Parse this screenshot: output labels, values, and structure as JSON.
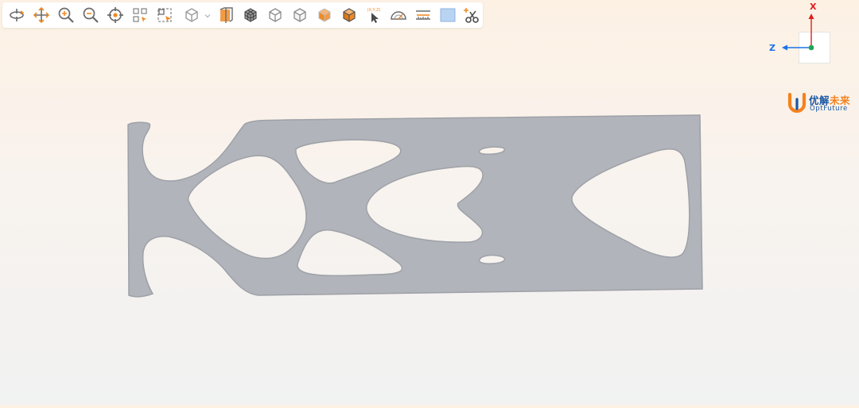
{
  "colors": {
    "icon_gray": "#6b6b6b",
    "accent_orange": "#f08a24",
    "part_gray": "#b1b4ba",
    "part_edge": "#9ea1a7",
    "axis_x": "#e02020",
    "axis_z": "#1a73e8",
    "axis_y": "#23a455",
    "logo_blue": "#1a57a5",
    "logo_orange": "#f5821f",
    "select_blue": "#b9d3f2"
  },
  "toolbar": {
    "buttons": [
      {
        "id": "rotate",
        "icon": "rotate-icon"
      },
      {
        "id": "pan",
        "icon": "pan-icon"
      },
      {
        "id": "zoom-in",
        "icon": "zoom-in-icon"
      },
      {
        "id": "zoom-out",
        "icon": "zoom-out-icon"
      },
      {
        "id": "fit-center",
        "icon": "crosshair-icon"
      },
      {
        "id": "zoom-window",
        "icon": "zoom-window-icon"
      },
      {
        "id": "zoom-box",
        "icon": "zoom-box-icon"
      },
      {
        "id": "view-cube-menu",
        "icon": "cube-dropdown-icon"
      },
      {
        "id": "section-view",
        "icon": "section-plane-icon"
      },
      {
        "id": "mesh-view",
        "icon": "mesh-cube-icon"
      },
      {
        "id": "wireframe-view",
        "icon": "wireframe-cube-icon"
      },
      {
        "id": "hidden-line-view",
        "icon": "hidden-line-cube-icon"
      },
      {
        "id": "shaded-edges-view",
        "icon": "shaded-edges-cube-icon"
      },
      {
        "id": "shaded-view",
        "icon": "shaded-cube-icon"
      },
      {
        "id": "coordinate-probe",
        "icon": "xyz-pointer-icon"
      },
      {
        "id": "angle-measure",
        "icon": "protractor-icon"
      },
      {
        "id": "distance-measure",
        "icon": "ruler-icon"
      },
      {
        "id": "background-color",
        "icon": "color-swatch-icon"
      },
      {
        "id": "section-cut",
        "icon": "scissors-icon"
      }
    ],
    "probe_label": "(X,Y,Z)"
  },
  "triad": {
    "x_label": "X",
    "z_label": "Z"
  },
  "logo": {
    "cn_part1": "优解",
    "cn_part2": "未来",
    "en": "OptFuture"
  }
}
